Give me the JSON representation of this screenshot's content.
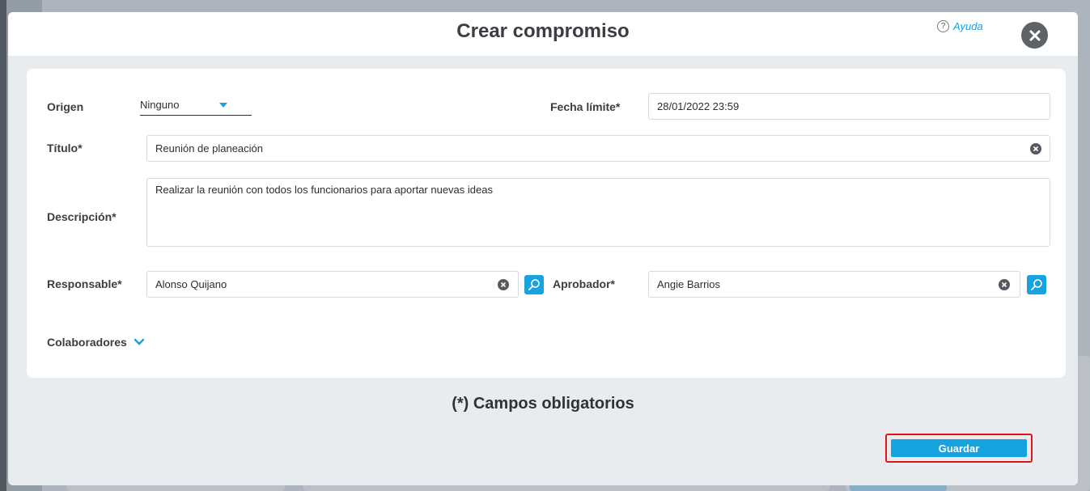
{
  "modal": {
    "title": "Crear compromiso",
    "help_label": "Ayuda",
    "close_icon": "close-icon"
  },
  "form": {
    "origen": {
      "label": "Origen",
      "value": "Ninguno"
    },
    "fecha_limite": {
      "label": "Fecha límite*",
      "value": "28/01/2022 23:59"
    },
    "titulo": {
      "label": "Título*",
      "value": "Reunión de planeación"
    },
    "descripcion": {
      "label": "Descripción*",
      "value": "Realizar la reunión con todos los funcionarios para aportar nuevas ideas"
    },
    "responsable": {
      "label": "Responsable*",
      "value": "Alonso Quijano"
    },
    "aprobador": {
      "label": "Aprobador*",
      "value": "Angie Barrios"
    },
    "colaboradores": {
      "label": "Colaboradores"
    }
  },
  "footer": {
    "required_note": "(*) Campos obligatorios",
    "save_label": "Guardar"
  },
  "colors": {
    "accent": "#17a3e0",
    "highlight": "#e0121b"
  }
}
